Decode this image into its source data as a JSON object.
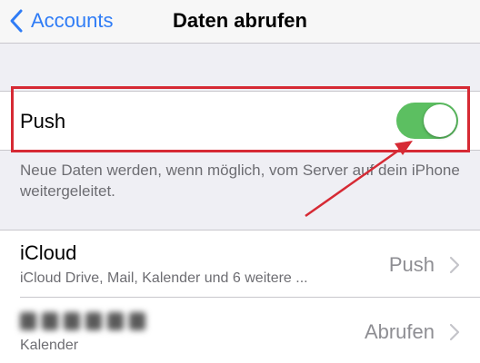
{
  "navbar": {
    "back_label": "Accounts",
    "title": "Daten abrufen"
  },
  "push": {
    "label": "Push",
    "enabled": true,
    "footer": "Neue Daten werden, wenn möglich, vom Server auf dein iPhone weitergeleitet."
  },
  "accounts": [
    {
      "title": "iCloud",
      "subtitle": "iCloud Drive, Mail, Kalender und 6 weitere ...",
      "value": "Push"
    },
    {
      "title": "",
      "subtitle": "Kalender",
      "value": "Abrufen"
    }
  ],
  "colors": {
    "accent": "#2f7cf6",
    "toggle_on": "#5cbf61",
    "annotation": "#d62a34"
  },
  "icons": {
    "back": "chevron-left-icon",
    "disclosure": "chevron-right-icon"
  }
}
